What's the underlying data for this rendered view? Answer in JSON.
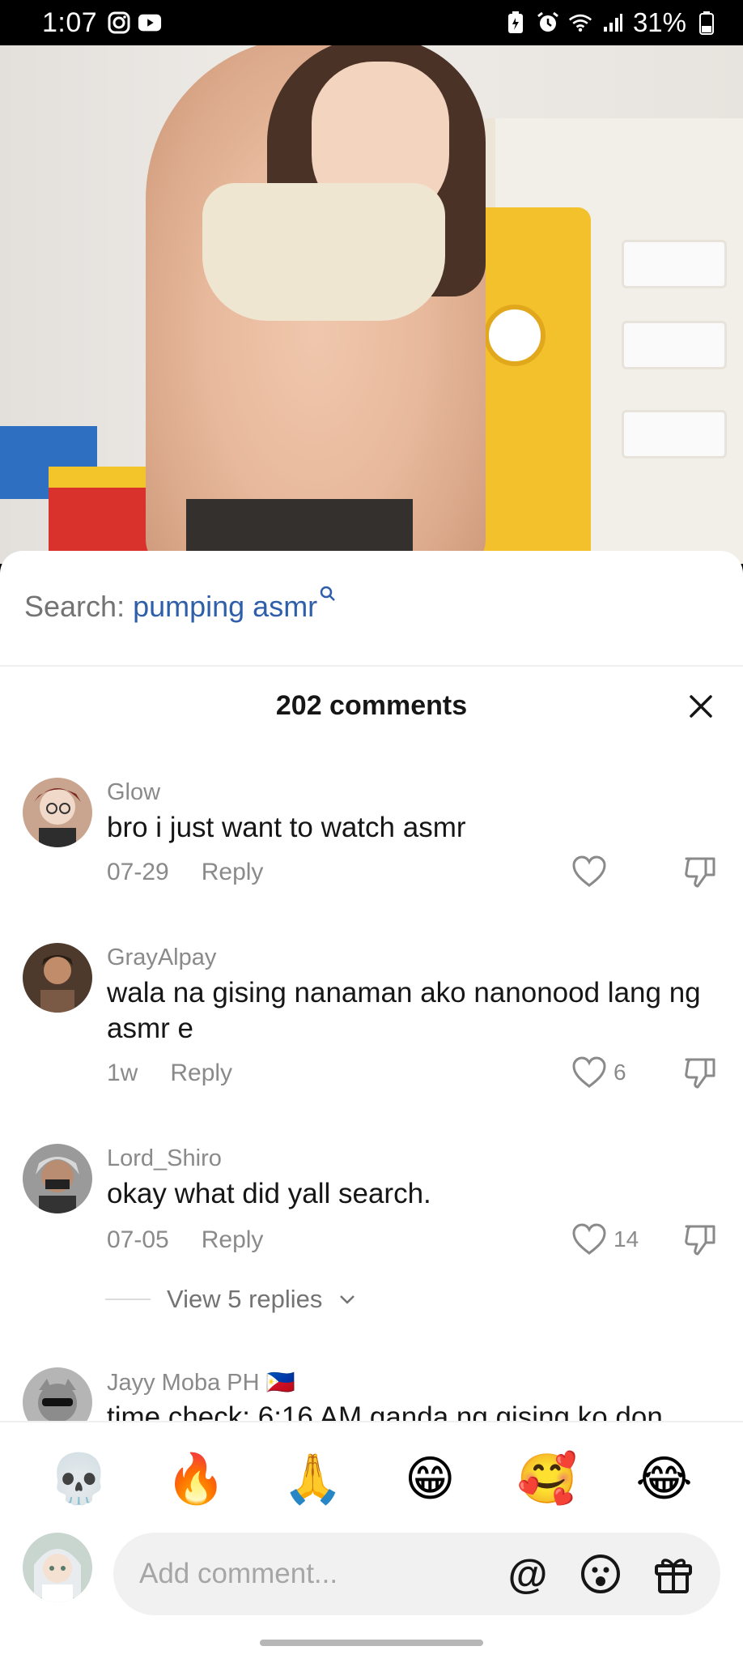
{
  "status_bar": {
    "time": "1:07",
    "battery": "31%",
    "icons": [
      "instagram-icon",
      "youtube-icon",
      "battery-saver-icon",
      "alarm-icon",
      "wifi-icon",
      "signal-icon"
    ]
  },
  "search": {
    "prefix": "Search:",
    "query": "pumping asmr"
  },
  "header": {
    "comment_count": "202 comments"
  },
  "comments": [
    {
      "user": "Glow",
      "text": "bro i just want to watch asmr",
      "time": "07-29",
      "reply": "Reply",
      "likes": ""
    },
    {
      "user": "GrayAlpay",
      "text": "wala na gising nanaman ako nanonood lang ng asmr e",
      "time": "1w",
      "reply": "Reply",
      "likes": "6"
    },
    {
      "user": "Lord_Shiro",
      "text": "okay what did yall search.",
      "time": "07-05",
      "reply": "Reply",
      "likes": "14"
    },
    {
      "user": "Jayy Moba PH 🇵🇭",
      "text": "time check: 6:16 AM ganda ng gising ko don",
      "time": "",
      "reply": "",
      "likes": ""
    }
  ],
  "view_replies": "View 5 replies",
  "emojis": [
    "💀",
    "🔥",
    "🙏",
    "😁",
    "🥰",
    "😂"
  ],
  "composer": {
    "placeholder": "Add comment...",
    "mention": "@"
  },
  "colors": {
    "accent": "#2f5fa8",
    "muted": "#8a8a8a",
    "text": "#161616"
  }
}
